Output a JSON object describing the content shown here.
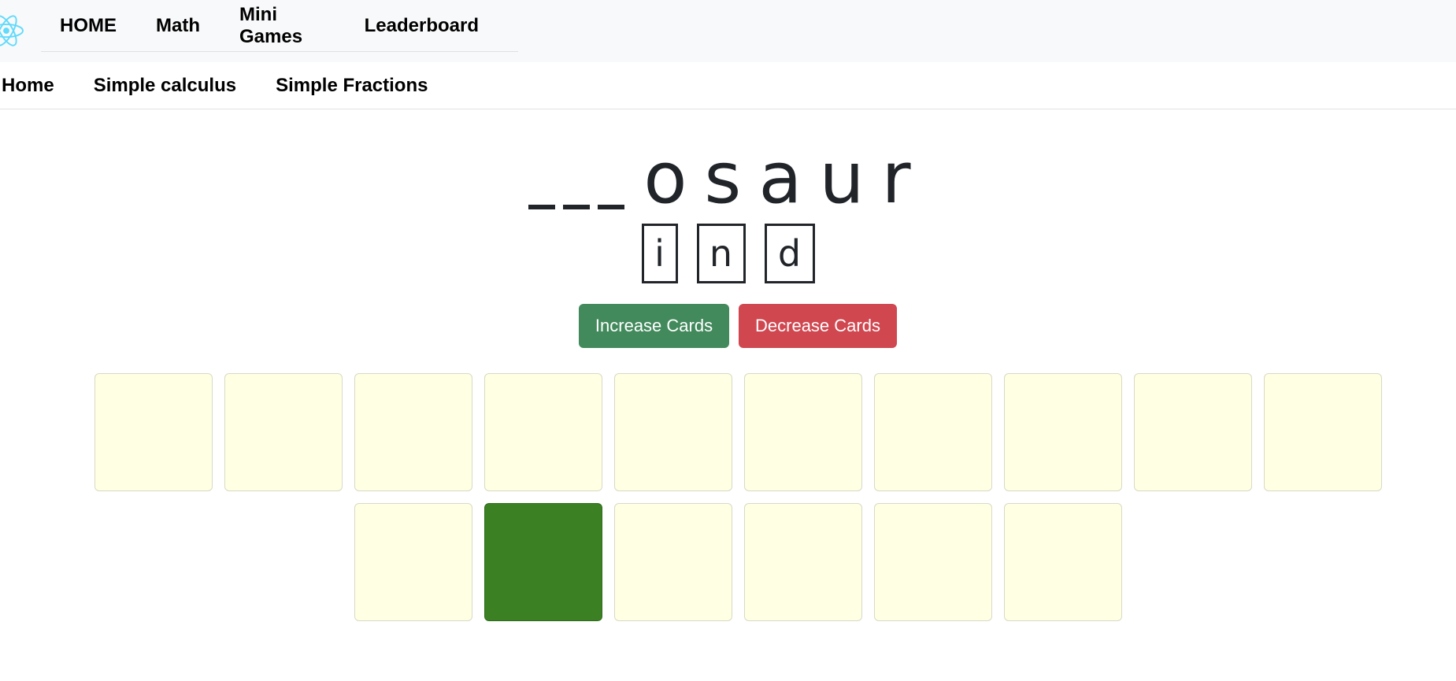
{
  "top_nav": {
    "items": [
      "HOME",
      "Math",
      "Mini Games",
      "Leaderboard"
    ]
  },
  "sub_nav": {
    "items": [
      "Home",
      "Simple calculus",
      "Simple Fractions"
    ]
  },
  "puzzle": {
    "blank_count": 3,
    "known_letters": [
      "o",
      "s",
      "a",
      "u",
      "r"
    ],
    "choices": [
      "i",
      "n",
      "d"
    ]
  },
  "controls": {
    "increase_label": "Increase Cards",
    "decrease_label": "Decrease Cards"
  },
  "colors": {
    "card": "#ffffe3",
    "card_found": "#3b8022",
    "increase": "#428a5c",
    "decrease": "#d04750"
  },
  "cards": {
    "rows": [
      {
        "count": 10,
        "found": []
      },
      {
        "count": 6,
        "found": [
          1
        ]
      }
    ]
  }
}
